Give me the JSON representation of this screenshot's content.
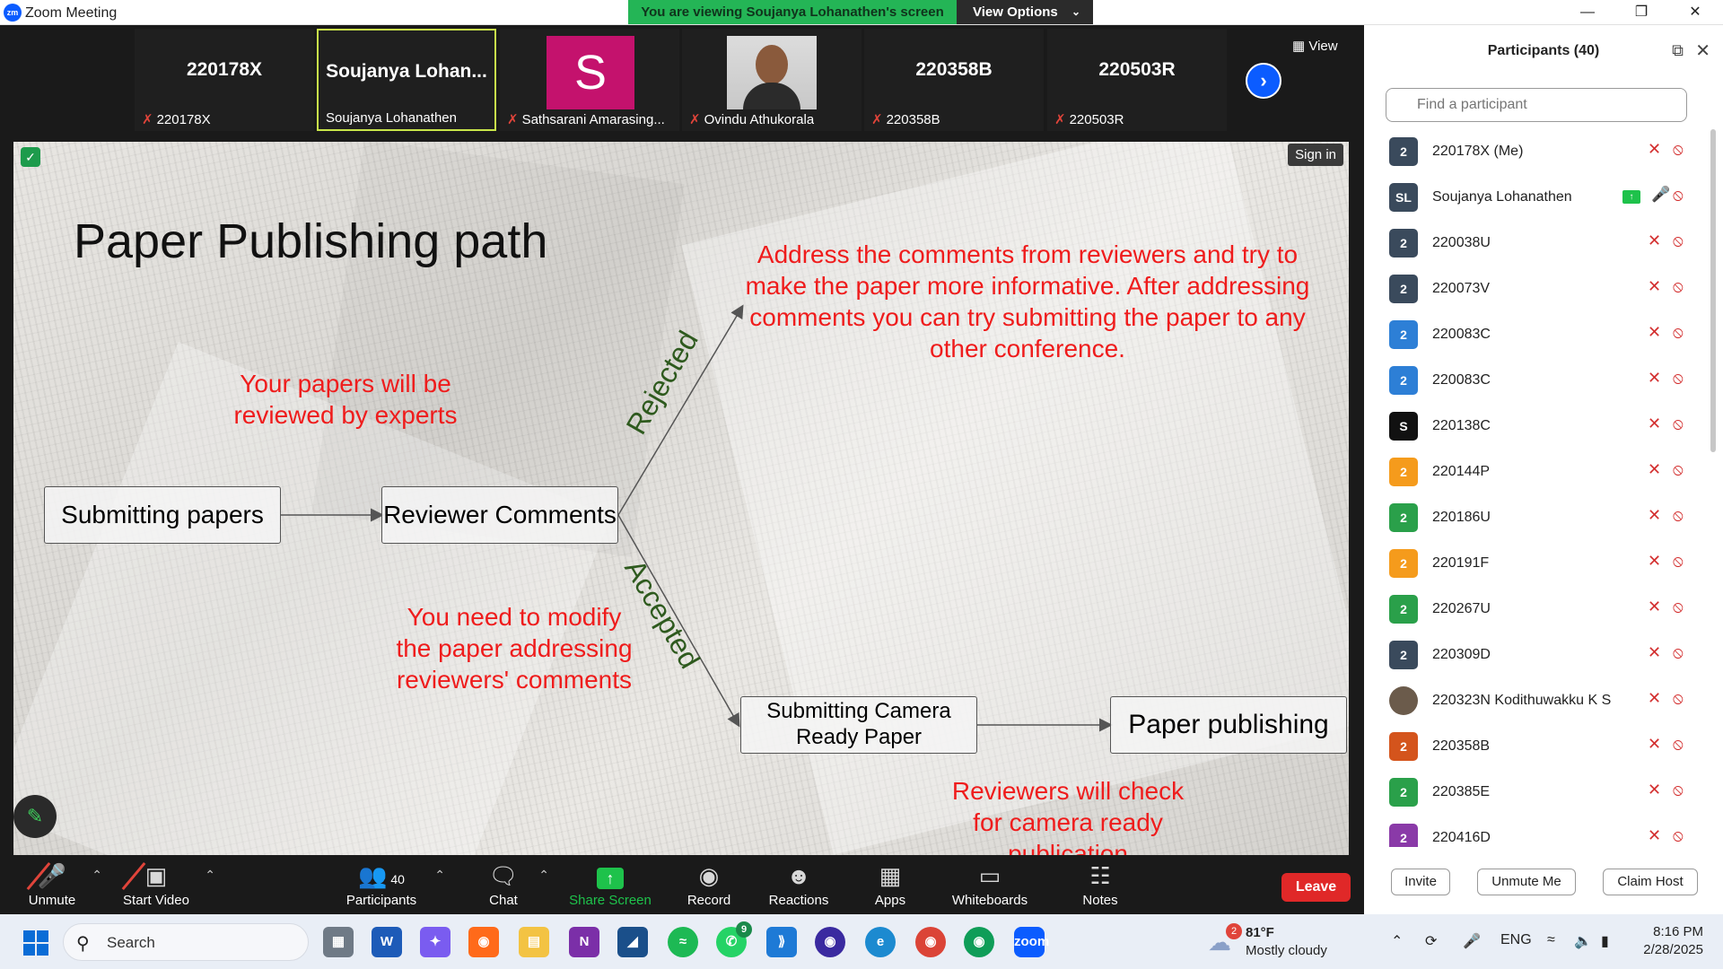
{
  "window": {
    "title": "Zoom Meeting",
    "app_icon": "zm",
    "banner_text": "You are viewing Soujanya Lohanathen's screen",
    "view_options_label": "View Options"
  },
  "gallery": {
    "view_label": "View",
    "tiles": [
      {
        "big": "220178X",
        "caption": "220178X"
      },
      {
        "big": "Soujanya  Lohan...",
        "caption": "Soujanya Lohanathen"
      },
      {
        "avatar_letter": "S",
        "caption": "Sathsarani Amarasing..."
      },
      {
        "caption": "Ovindu Athukorala"
      },
      {
        "big": "220358B",
        "caption": "220358B"
      },
      {
        "big": "220503R",
        "caption": "220503R"
      }
    ]
  },
  "slide": {
    "sign_in": "Sign in",
    "title": "Paper Publishing path",
    "note_review": "Your papers will be reviewed by experts",
    "note_reject": "Address the comments from reviewers and try to make the paper more informative. After addressing comments you can try submitting the paper to any other conference.",
    "note_modify": "You need to modify the paper addressing reviewers' comments",
    "note_camera": "Reviewers will check for camera ready publication",
    "box_submit": "Submitting papers",
    "box_review": "Reviewer Comments",
    "box_camera": "Submitting Camera Ready Paper",
    "box_publish": "Paper publishing",
    "label_rejected": "Rejected",
    "label_accepted": "Accepted"
  },
  "toolbar": {
    "unmute": "Unmute",
    "start_video": "Start Video",
    "participants": "Participants",
    "participants_count": "40",
    "chat": "Chat",
    "share_screen": "Share Screen",
    "record": "Record",
    "reactions": "Reactions",
    "apps": "Apps",
    "whiteboards": "Whiteboards",
    "notes": "Notes",
    "leave": "Leave"
  },
  "participants_panel": {
    "title": "Participants (40)",
    "search_placeholder": "Find a participant",
    "participants": [
      {
        "initials": "2",
        "name": "220178X (Me)",
        "color": "#3a4a5c"
      },
      {
        "initials": "SL",
        "name": "Soujanya Lohanathen",
        "color": "#3a4a5c",
        "sharing": true
      },
      {
        "initials": "2",
        "name": "220038U",
        "color": "#3a4a5c"
      },
      {
        "initials": "2",
        "name": "220073V",
        "color": "#3a4a5c"
      },
      {
        "initials": "2",
        "name": "220083C",
        "color": "#2d7fd6"
      },
      {
        "initials": "2",
        "name": "220083C",
        "color": "#2d7fd6"
      },
      {
        "initials": "S",
        "name": "220138C",
        "color": "#111111"
      },
      {
        "initials": "2",
        "name": "220144P",
        "color": "#f59b1c"
      },
      {
        "initials": "2",
        "name": "220186U",
        "color": "#2aa04a"
      },
      {
        "initials": "2",
        "name": "220191F",
        "color": "#f59b1c"
      },
      {
        "initials": "2",
        "name": "220267U",
        "color": "#2aa04a"
      },
      {
        "initials": "2",
        "name": "220309D",
        "color": "#3a4a5c"
      },
      {
        "initials": "",
        "name": "220323N Kodithuwakku K S",
        "color": "#6b5b4b",
        "photo": true
      },
      {
        "initials": "2",
        "name": "220358B",
        "color": "#d4541c"
      },
      {
        "initials": "2",
        "name": "220385E",
        "color": "#2aa04a"
      },
      {
        "initials": "2",
        "name": "220416D",
        "color": "#8a3aa8"
      }
    ],
    "invite": "Invite",
    "unmute_me": "Unmute Me",
    "claim_host": "Claim Host"
  },
  "taskbar": {
    "search_label": "Search",
    "weather_badge": "2",
    "temperature": "81°F",
    "weather": "Mostly cloudy",
    "whatsapp_badge": "9",
    "language": "ENG",
    "time": "8:16 PM",
    "date": "2/28/2025"
  }
}
